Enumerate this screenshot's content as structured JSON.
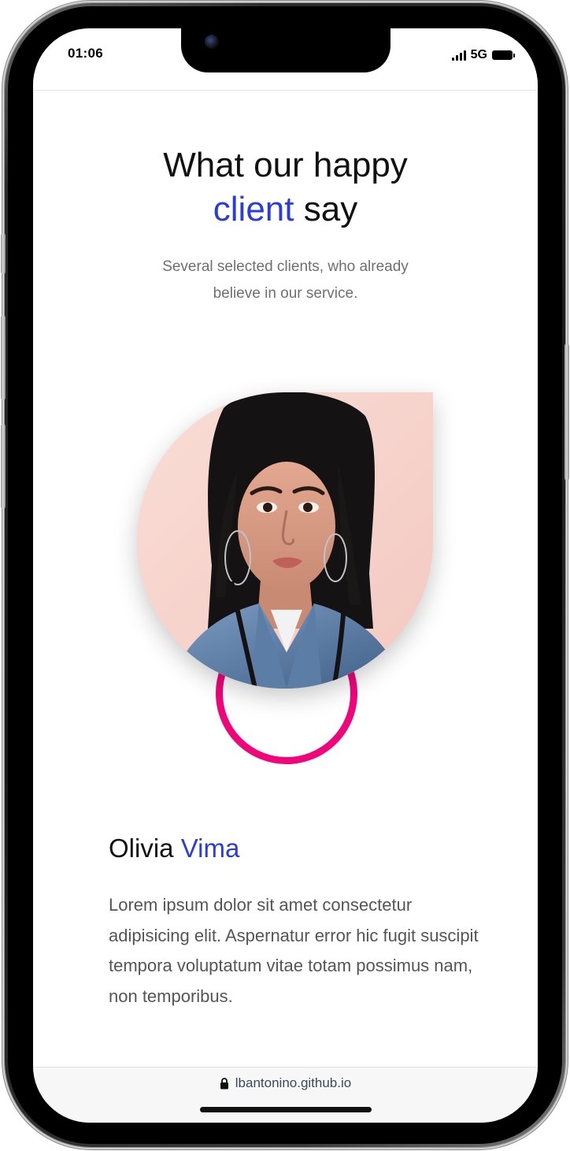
{
  "status_bar": {
    "time": "01:06",
    "network": "5G"
  },
  "hero": {
    "title_line1": "What our happy",
    "title_accent": "client",
    "title_rest": " say",
    "subtitle_line1": "Several selected clients, who already",
    "subtitle_line2": "believe in our service."
  },
  "testimonial": {
    "first_name": "Olivia",
    "last_name": "Vima",
    "quote": "Lorem ipsum dolor sit amet consectetur adipisicing elit. Aspernatur error hic fugit suscipit tempora voluptatum vitae totam possimus nam, non temporibus."
  },
  "browser": {
    "url": "lbantonino.github.io"
  },
  "colors": {
    "accent_blue": "#2a3be0",
    "ring_pink": "#f0057a"
  }
}
